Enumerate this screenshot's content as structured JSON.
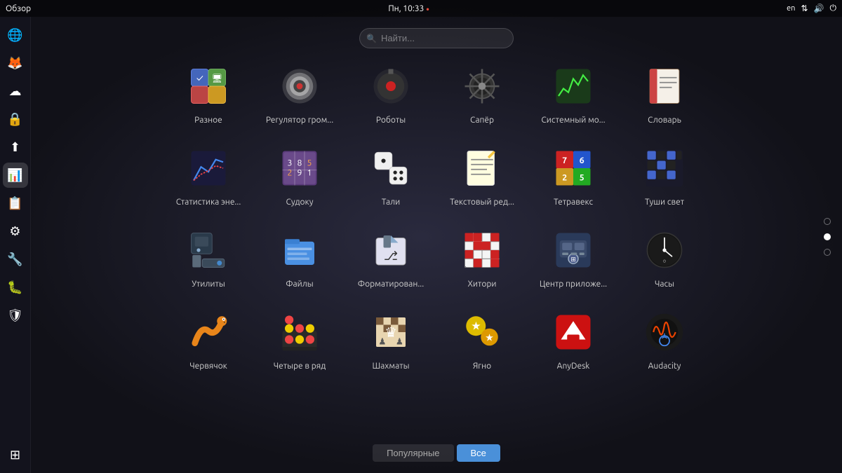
{
  "topbar": {
    "left_label": "Обзор",
    "time": "Пн, 10:33",
    "dot": "●",
    "right_lang": "en",
    "right_net": "⇅",
    "right_vol": "🔊",
    "right_power": "⏻"
  },
  "search": {
    "placeholder": "Найти..."
  },
  "apps": [
    {
      "id": "misc",
      "label": "Разное",
      "icon_type": "misc",
      "emoji": "🗂"
    },
    {
      "id": "volume",
      "label": "Регулятор гром...",
      "icon_type": "volume",
      "emoji": "🔊"
    },
    {
      "id": "robots",
      "label": "Роботы",
      "icon_type": "robots",
      "emoji": "🤖"
    },
    {
      "id": "minesweeper",
      "label": "Сапёр",
      "icon_type": "minesweeper",
      "emoji": "💣"
    },
    {
      "id": "sysmon",
      "label": "Системный мо...",
      "icon_type": "sysmon",
      "emoji": "📊"
    },
    {
      "id": "dict",
      "label": "Словарь",
      "icon_type": "dict",
      "emoji": "📖"
    },
    {
      "id": "stats",
      "label": "Статистика эне...",
      "icon_type": "stats",
      "emoji": "📈"
    },
    {
      "id": "sudoku",
      "label": "Судоку",
      "icon_type": "sudoku",
      "emoji": "🔢"
    },
    {
      "id": "tali",
      "label": "Тали",
      "icon_type": "tali",
      "emoji": "🎲"
    },
    {
      "id": "texteditor",
      "label": "Текстовый ред...",
      "icon_type": "texteditor",
      "emoji": "📝"
    },
    {
      "id": "tetravex",
      "label": "Тетравекс",
      "icon_type": "tetravex",
      "emoji": "🧩"
    },
    {
      "id": "lightsout",
      "label": "Туши свет",
      "icon_type": "lightsout",
      "emoji": "⬛"
    },
    {
      "id": "utils",
      "label": "Утилиты",
      "icon_type": "utils",
      "emoji": "🔧"
    },
    {
      "id": "files",
      "label": "Файлы",
      "icon_type": "files",
      "emoji": "📁"
    },
    {
      "id": "format",
      "label": "Форматирован...",
      "icon_type": "format",
      "emoji": "💾"
    },
    {
      "id": "hitori",
      "label": "Хитори",
      "icon_type": "hitori",
      "emoji": "🎯"
    },
    {
      "id": "center",
      "label": "Центр приложе...",
      "icon_type": "center",
      "emoji": "🛒"
    },
    {
      "id": "clock",
      "label": "Часы",
      "icon_type": "clock",
      "emoji": "🕐"
    },
    {
      "id": "worm",
      "label": "Червячок",
      "icon_type": "worm",
      "emoji": "🐛"
    },
    {
      "id": "fourinarow",
      "label": "Четыре в ряд",
      "icon_type": "fourinarow",
      "emoji": "⚫"
    },
    {
      "id": "chess",
      "label": "Шахматы",
      "icon_type": "chess",
      "emoji": "♟"
    },
    {
      "id": "jagno",
      "label": "Ягно",
      "icon_type": "jagno",
      "emoji": "⭐"
    },
    {
      "id": "anydesk",
      "label": "AnyDesk",
      "icon_type": "anydesk",
      "emoji": "▶"
    },
    {
      "id": "audacity",
      "label": "Audacity",
      "icon_type": "audacity",
      "emoji": "🎧"
    }
  ],
  "sidebar": {
    "items": [
      {
        "id": "globe",
        "emoji": "🌐"
      },
      {
        "id": "firefox",
        "emoji": "🦊"
      },
      {
        "id": "cloud",
        "emoji": "☁"
      },
      {
        "id": "lock",
        "emoji": "🔒"
      },
      {
        "id": "upload",
        "emoji": "⬆"
      },
      {
        "id": "spreadsheet",
        "emoji": "📊"
      },
      {
        "id": "notes",
        "emoji": "📋"
      },
      {
        "id": "terminal",
        "emoji": "⚙"
      },
      {
        "id": "settings",
        "emoji": "🔧"
      },
      {
        "id": "bug",
        "emoji": "🐛"
      },
      {
        "id": "shield",
        "emoji": "🛡"
      },
      {
        "id": "grid",
        "emoji": "⊞"
      }
    ]
  },
  "tabs": {
    "popular_label": "Популярные",
    "all_label": "Все"
  },
  "pagination": {
    "dots": [
      false,
      true,
      false
    ]
  }
}
